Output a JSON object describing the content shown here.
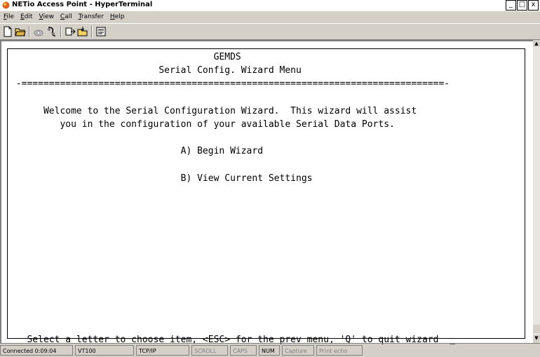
{
  "window": {
    "title": "NETio Access Point - HyperTerminal",
    "buttons": {
      "minimize": "_",
      "maximize": "□",
      "close": "x"
    }
  },
  "menu": [
    {
      "accel": "F",
      "rest": "ile"
    },
    {
      "accel": "E",
      "rest": "dit"
    },
    {
      "accel": "V",
      "rest": "iew"
    },
    {
      "accel": "C",
      "rest": "all"
    },
    {
      "accel": "T",
      "rest": "ransfer"
    },
    {
      "accel": "H",
      "rest": "elp"
    }
  ],
  "toolbar": [
    "new-file-icon",
    "open-folder-icon",
    "phone-icon",
    "disconnect-icon",
    "send-file-icon",
    "receive-file-icon",
    "properties-icon"
  ],
  "terminal": {
    "lines": [
      "                                     GEMDS",
      "                           Serial Config. Wizard Menu",
      " -=============================================================================-",
      "",
      "      Welcome to the Serial Configuration Wizard.  This wizard will assist",
      "         you in the configuration of your available Serial Data Ports.",
      "",
      "                               A) Begin Wizard",
      "",
      "                               B) View Current Settings",
      "",
      "",
      "",
      "",
      "",
      "",
      "",
      "",
      "",
      "",
      "",
      "   Select a letter to choose item, <ESC> for the prev menu, 'Q' to quit wizard  _"
    ]
  },
  "status": {
    "connected": "Connected 0:09:04",
    "emulation": "VT100",
    "protocol": "TCP/IP",
    "scroll": "SCROLL",
    "caps": "CAPS",
    "num": "NUM",
    "capture": "Capture",
    "print_echo": "Print echo"
  }
}
